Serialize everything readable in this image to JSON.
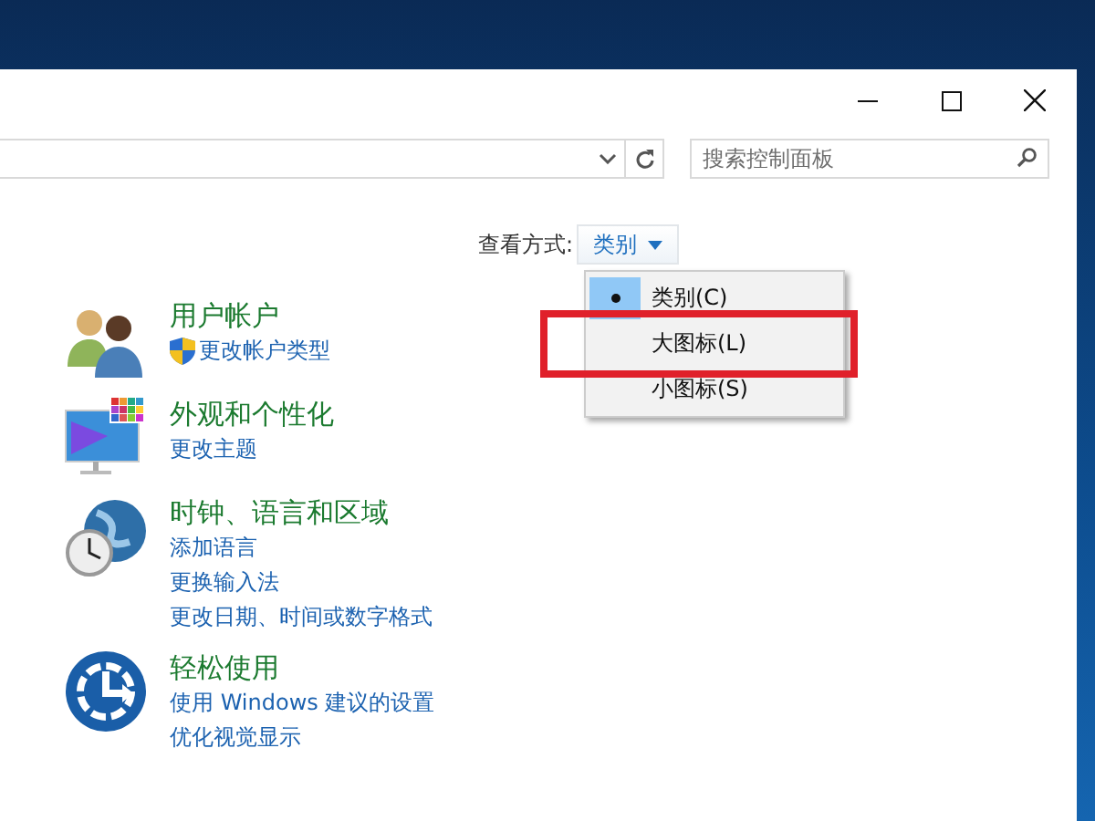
{
  "window": {
    "caption_buttons": [
      {
        "kind": "minimize"
      },
      {
        "kind": "maximize"
      },
      {
        "kind": "close"
      }
    ]
  },
  "search": {
    "placeholder": "搜索控制面板"
  },
  "view_by": {
    "label": "查看方式:",
    "value": "类别",
    "expanded": true,
    "options": [
      {
        "label": "类别(C)",
        "selected": true
      },
      {
        "label": "大图标(L)",
        "selected": false,
        "highlighted": true
      },
      {
        "label": "小图标(S)",
        "selected": false,
        "highlighted": false
      }
    ]
  },
  "categories": [
    {
      "kind": "users",
      "title": "用户帐户",
      "links": [
        {
          "text": "更改帐户类型",
          "shield": true
        }
      ]
    },
    {
      "kind": "appearance",
      "title": "外观和个性化",
      "links": [
        {
          "text": "更改主题",
          "shield": false
        }
      ]
    },
    {
      "kind": "clock",
      "title": "时钟、语言和区域",
      "links": [
        {
          "text": "添加语言",
          "shield": false
        },
        {
          "text": "更换输入法",
          "shield": false
        },
        {
          "text": "更改日期、时间或数字格式",
          "shield": false
        }
      ]
    },
    {
      "kind": "ease",
      "title": "轻松使用",
      "links": [
        {
          "text": "使用 Windows 建议的设置",
          "shield": false
        },
        {
          "text": "优化视觉显示",
          "shield": false
        }
      ]
    }
  ]
}
